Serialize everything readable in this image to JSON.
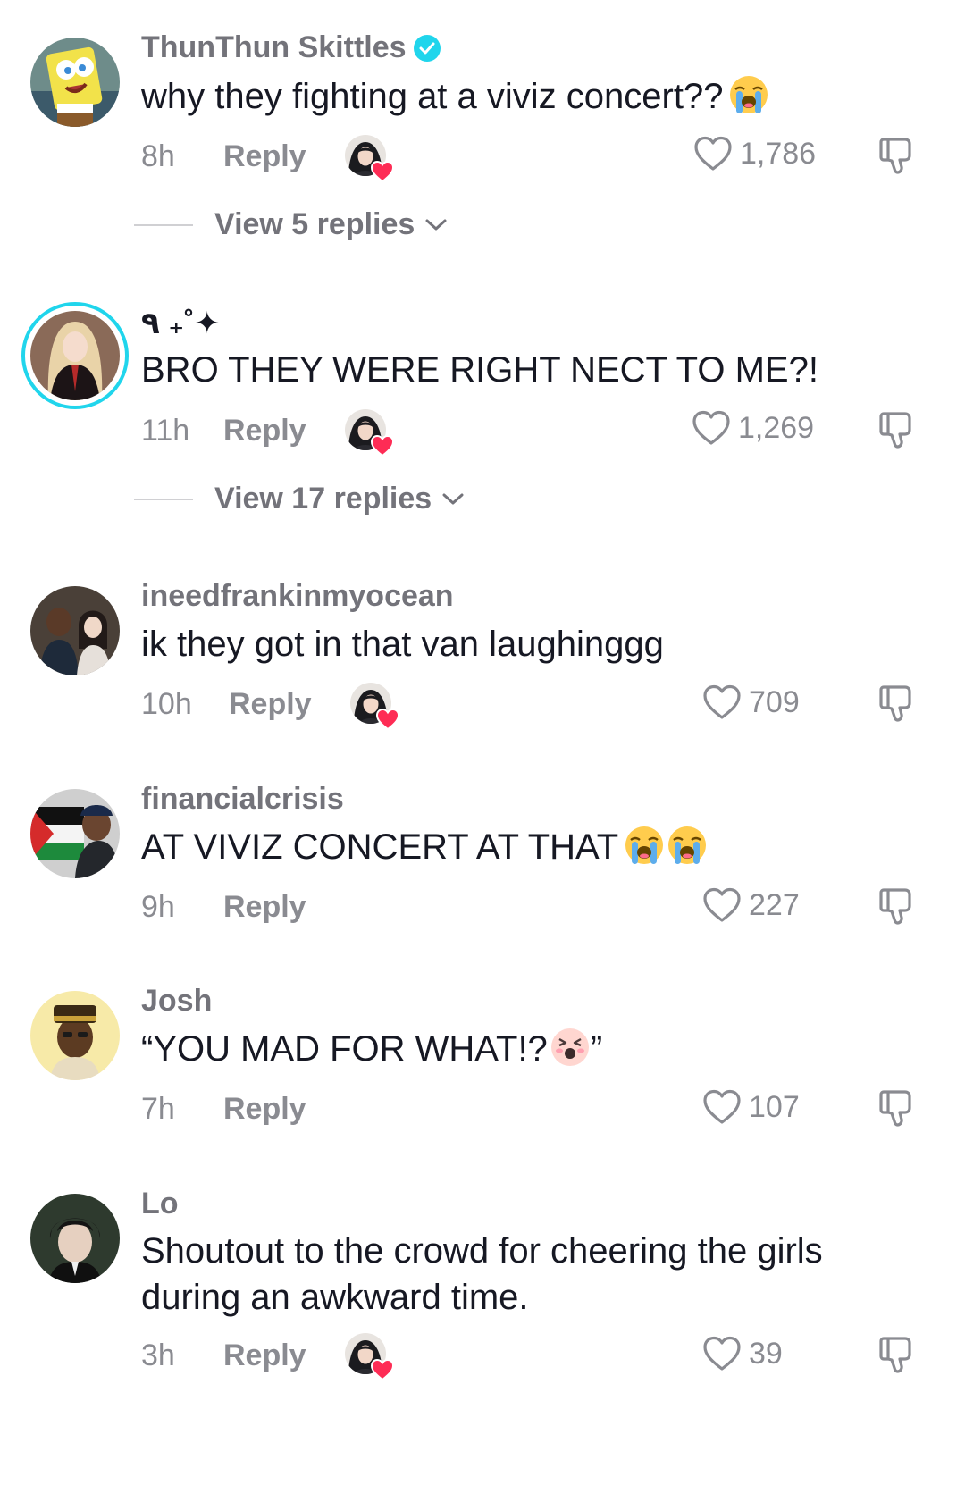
{
  "comments": [
    {
      "username": "ThunThun Skittles",
      "verified": true,
      "text": "why they fighting at a viviz concert??",
      "emoji": [
        "loudly-crying-face"
      ],
      "time": "8h",
      "reply_label": "Reply",
      "creator_liked": true,
      "likes": "1,786",
      "replies_label": "View 5 replies"
    },
    {
      "username": "٩ ₊˚✦",
      "verified": false,
      "text": "BRO THEY WERE RIGHT NECT TO ME?!",
      "time": "11h",
      "reply_label": "Reply",
      "creator_liked": true,
      "likes": "1,269",
      "replies_label": "View 17 replies"
    },
    {
      "username": "ineedfrankinmyocean",
      "verified": false,
      "text": "ik they got in that van laughinggg",
      "time": "10h",
      "reply_label": "Reply",
      "creator_liked": true,
      "likes": "709"
    },
    {
      "username": "financialcrisis",
      "verified": false,
      "text": "AT VIVIZ CONCERT AT THAT",
      "emoji": [
        "loudly-crying-face",
        "loudly-crying-face"
      ],
      "time": "9h",
      "reply_label": "Reply",
      "creator_liked": false,
      "likes": "227"
    },
    {
      "username": "Josh",
      "verified": false,
      "text_before": "“YOU MAD FOR WHAT!?",
      "text_after": "”",
      "emoji": [
        "tired-face"
      ],
      "time": "7h",
      "reply_label": "Reply",
      "creator_liked": false,
      "likes": "107"
    },
    {
      "username": "Lo",
      "verified": false,
      "text": "Shoutout to the crowd for cheering the girls during an awkward time.",
      "time": "3h",
      "reply_label": "Reply",
      "creator_liked": true,
      "likes": "39"
    }
  ],
  "icons": {
    "like": "heart-outline-icon",
    "dislike": "thumbs-down-icon",
    "verified": "verified-check-icon",
    "expand": "chevron-down-icon",
    "creator_heart": "red-heart-icon"
  },
  "colors": {
    "verified": "#20d5ec",
    "story_ring": "#20d5ec",
    "heart_red": "#fe2c55",
    "muted_text": "#8a8b91"
  }
}
